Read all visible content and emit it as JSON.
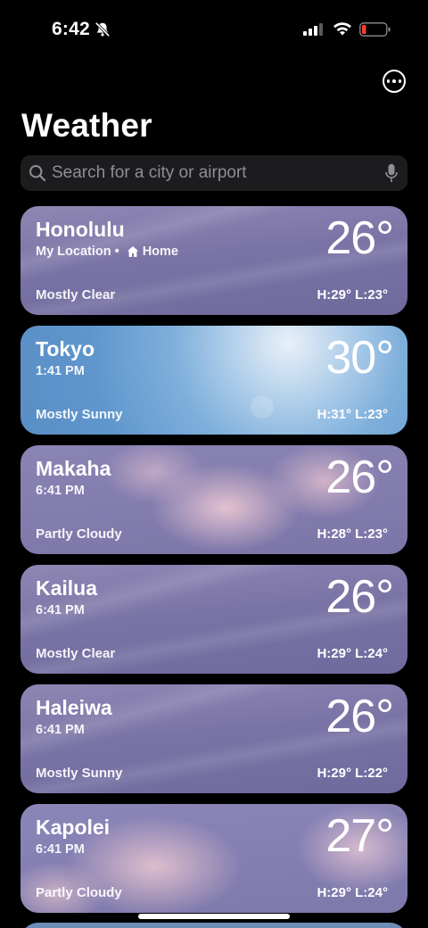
{
  "status_bar": {
    "time": "6:42",
    "icons": [
      "bell-slash-icon",
      "cellular-signal-icon",
      "wifi-icon",
      "battery-low-icon"
    ],
    "battery_color": "#ff3b30"
  },
  "header": {
    "more_icon": "ellipsis-circle-icon",
    "title": "Weather"
  },
  "search": {
    "placeholder": "Search for a city or airport",
    "icons": [
      "search-icon",
      "microphone-icon"
    ]
  },
  "cities": [
    {
      "name": "Honolulu",
      "sub": "My Location •",
      "sub_extra": "Home",
      "temp": "26°",
      "condition": "Mostly Clear",
      "hilo": "H:29°  L:23°"
    },
    {
      "name": "Tokyo",
      "sub": "1:41 PM",
      "temp": "30°",
      "condition": "Mostly Sunny",
      "hilo": "H:31°  L:23°"
    },
    {
      "name": "Makaha",
      "sub": "6:41 PM",
      "temp": "26°",
      "condition": "Partly Cloudy",
      "hilo": "H:28°  L:23°"
    },
    {
      "name": "Kailua",
      "sub": "6:41 PM",
      "temp": "26°",
      "condition": "Mostly Clear",
      "hilo": "H:29°  L:24°"
    },
    {
      "name": "Haleiwa",
      "sub": "6:41 PM",
      "temp": "26°",
      "condition": "Mostly Sunny",
      "hilo": "H:29°  L:22°"
    },
    {
      "name": "Kapolei",
      "sub": "6:41 PM",
      "temp": "27°",
      "condition": "Partly Cloudy",
      "hilo": "H:29°  L:24°"
    }
  ]
}
